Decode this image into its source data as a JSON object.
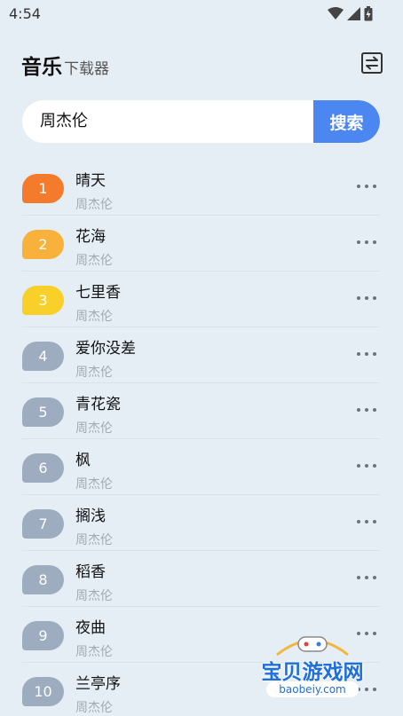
{
  "status_bar": {
    "time": "4:54"
  },
  "header": {
    "title": "音乐",
    "subtitle": "下载器"
  },
  "search": {
    "query": "周杰伦",
    "button_label": "搜索"
  },
  "songs": [
    {
      "rank": "1",
      "title": "晴天",
      "artist": "周杰伦",
      "badge_color": "#f47a2c"
    },
    {
      "rank": "2",
      "title": "花海",
      "artist": "周杰伦",
      "badge_color": "#f8b13a"
    },
    {
      "rank": "3",
      "title": "七里香",
      "artist": "周杰伦",
      "badge_color": "#f9d02a"
    },
    {
      "rank": "4",
      "title": "爱你没差",
      "artist": "周杰伦",
      "badge_color": "#9eacc0"
    },
    {
      "rank": "5",
      "title": "青花瓷",
      "artist": "周杰伦",
      "badge_color": "#9eacc0"
    },
    {
      "rank": "6",
      "title": "枫",
      "artist": "周杰伦",
      "badge_color": "#9eacc0"
    },
    {
      "rank": "7",
      "title": "搁浅",
      "artist": "周杰伦",
      "badge_color": "#9eacc0"
    },
    {
      "rank": "8",
      "title": "稻香",
      "artist": "周杰伦",
      "badge_color": "#9eacc0"
    },
    {
      "rank": "9",
      "title": "夜曲",
      "artist": "周杰伦",
      "badge_color": "#9eacc0"
    },
    {
      "rank": "10",
      "title": "兰亭序",
      "artist": "周杰伦",
      "badge_color": "#9eacc0"
    }
  ],
  "watermark": {
    "text": "宝贝游戏网",
    "url": "baobeiy.com"
  },
  "icons": {
    "wifi": "wifi-icon",
    "signal": "signal-icon",
    "battery": "battery-icon",
    "switch": "switch-source-icon",
    "more": "more-icon"
  }
}
